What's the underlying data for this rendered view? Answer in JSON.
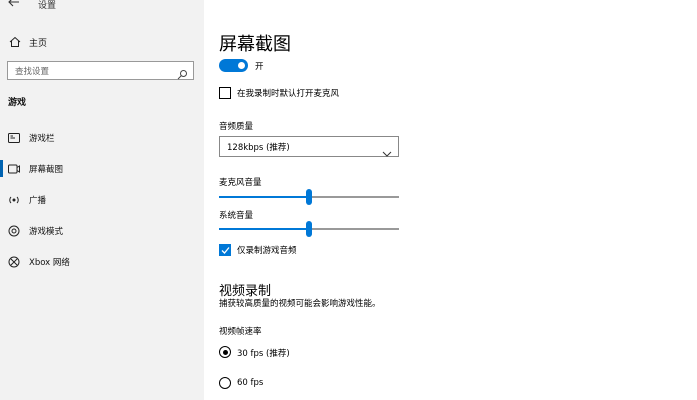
{
  "window": {
    "title": "设置"
  },
  "sidebar": {
    "home_label": "主页",
    "search_placeholder": "查找设置",
    "section_title": "游戏",
    "items": [
      {
        "label": "游戏栏",
        "icon": "game-bar-icon"
      },
      {
        "label": "屏幕截图",
        "icon": "capture-icon",
        "selected": true
      },
      {
        "label": "广播",
        "icon": "broadcast-icon"
      },
      {
        "label": "游戏模式",
        "icon": "game-mode-icon"
      },
      {
        "label": "Xbox 网络",
        "icon": "xbox-icon"
      }
    ]
  },
  "main": {
    "title": "屏幕截图",
    "background_record": {
      "state_label": "开",
      "on": true
    },
    "mic_record_checkbox": {
      "label": "在我录制时默认打开麦克风",
      "checked": false
    },
    "audio_quality": {
      "label": "音频质量",
      "value": "128kbps (推荐)"
    },
    "mic_volume": {
      "label": "麦克风音量",
      "level": 0.5
    },
    "system_volume": {
      "label": "系统音量",
      "level": 0.5
    },
    "game_audio_only": {
      "label": "仅录制游戏音频",
      "checked": true
    },
    "video_section": {
      "title": "视频录制",
      "description": "捕获较高质量的视频可能会影响游戏性能。",
      "frame_rate_label": "视频帧速率",
      "options": [
        {
          "label": "30 fps (推荐)",
          "selected": true
        },
        {
          "label": "60 fps",
          "selected": false
        }
      ]
    }
  },
  "colors": {
    "accent": "#0078d7",
    "sidebar_bg": "#f2f2f2"
  }
}
